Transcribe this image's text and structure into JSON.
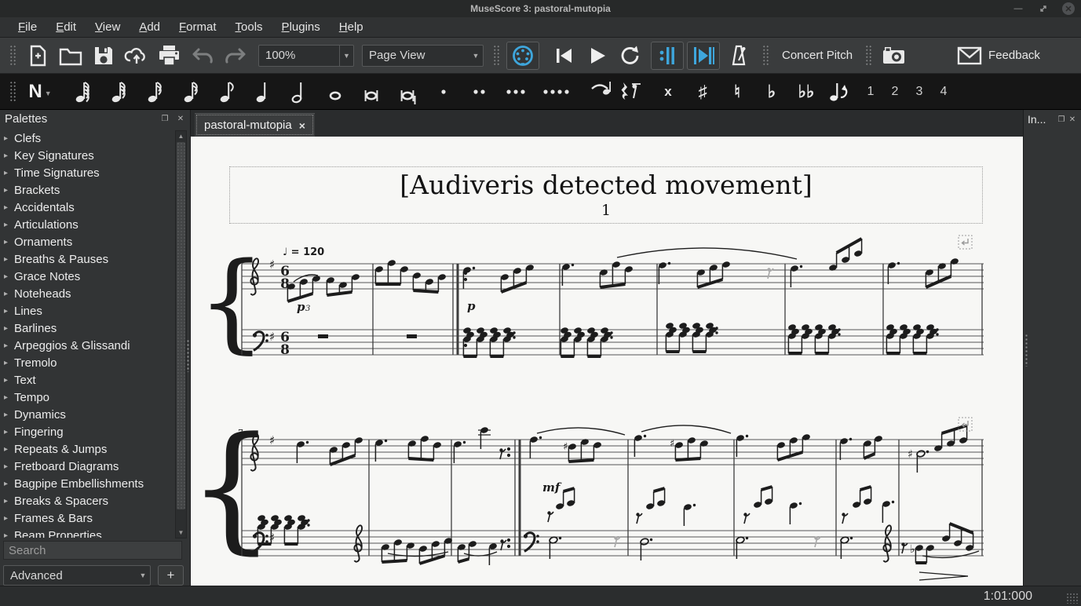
{
  "window": {
    "title": "MuseScore 3: pastoral-mutopia"
  },
  "menu": {
    "items": [
      "File",
      "Edit",
      "View",
      "Add",
      "Format",
      "Tools",
      "Plugins",
      "Help"
    ]
  },
  "toolbar": {
    "zoom_value": "100%",
    "view_mode": "Page View",
    "concert_pitch_label": "Concert Pitch",
    "feedback_label": "Feedback"
  },
  "note_input": {
    "durations": [
      {
        "name": "note-128th",
        "flags": 4,
        "open": false
      },
      {
        "name": "note-64th",
        "flags": 3,
        "open": false
      },
      {
        "name": "note-32nd",
        "flags": 2,
        "open": false
      },
      {
        "name": "note-16th",
        "flags": 2,
        "open": false
      },
      {
        "name": "note-eighth",
        "flags": 1,
        "open": false
      },
      {
        "name": "note-quarter",
        "flags": 0,
        "open": false
      },
      {
        "name": "note-half",
        "flags": 0,
        "open": true
      },
      {
        "name": "note-whole",
        "flags": 0,
        "open": true,
        "nostem": true
      },
      {
        "name": "note-breve",
        "flags": 0,
        "open": true,
        "nostem": true,
        "bars": true
      },
      {
        "name": "note-longa",
        "flags": 0,
        "open": true,
        "bars": true
      }
    ],
    "dots": [
      {
        "name": "augmentation-dot",
        "count": 1
      },
      {
        "name": "double-dot",
        "count": 2
      },
      {
        "name": "triple-dot",
        "count": 3
      },
      {
        "name": "quadruple-dot",
        "count": 4
      }
    ],
    "accidentals": [
      {
        "name": "double-sharp",
        "glyph": "x"
      },
      {
        "name": "sharp",
        "glyph": "♯"
      },
      {
        "name": "natural",
        "glyph": "♮"
      },
      {
        "name": "flat",
        "glyph": "♭"
      },
      {
        "name": "double-flat",
        "glyph": "♭♭"
      }
    ],
    "voices": [
      "1",
      "2",
      "3",
      "4"
    ]
  },
  "palettes": {
    "title": "Palettes",
    "items": [
      "Clefs",
      "Key Signatures",
      "Time Signatures",
      "Brackets",
      "Accidentals",
      "Articulations",
      "Ornaments",
      "Breaths & Pauses",
      "Grace Notes",
      "Noteheads",
      "Lines",
      "Barlines",
      "Arpeggios & Glissandi",
      "Tremolo",
      "Text",
      "Tempo",
      "Dynamics",
      "Fingering",
      "Repeats & Jumps",
      "Fretboard Diagrams",
      "Bagpipe Embellishments",
      "Breaks & Spacers",
      "Frames & Bars",
      "Beam Properties"
    ],
    "search_placeholder": "Search",
    "workspace": "Advanced",
    "add_button": "+"
  },
  "tab": {
    "label": "pastoral-mutopia",
    "close": "×"
  },
  "inspector": {
    "title": "In..."
  },
  "status": {
    "playback_position": "1:01:000"
  },
  "colors": {
    "accent_blue": "#3ea6dc",
    "paper": "#f7f7f5",
    "ink": "#1c1c1c"
  },
  "score": {
    "title": "[Audiveris detected movement]",
    "subtitle": "1",
    "tempo": "♩ = 120",
    "time_signature": "6/8",
    "music": {
      "sys1": [
        [
          "st",
          65,
          1010,
          162
        ],
        [
          "st",
          65,
          1010,
          246
        ],
        [
          "br",
          52,
          162,
          278
        ],
        [
          "bl",
          65,
          162,
          278
        ],
        [
          "bl",
          232,
          162,
          278
        ],
        [
          "bl",
          334,
          162,
          278
        ],
        [
          "bl",
          340,
          162,
          278,
          3
        ],
        [
          "do",
          350,
          [
            174,
            182
          ]
        ],
        [
          "do",
          350,
          [
            258,
            266
          ]
        ],
        [
          "bl",
          470,
          162,
          278
        ],
        [
          "bl",
          594,
          162,
          278
        ],
        [
          "bl",
          757,
          162,
          278
        ],
        [
          "bl",
          882,
          162,
          278
        ],
        [
          "bl",
          1008,
          162,
          278
        ],
        [
          "gc",
          76,
          162
        ],
        [
          "fc",
          80,
          246
        ],
        [
          "tx",
          100,
          168,
          "♯",
          15,
          "b"
        ],
        [
          "tx",
          100,
          260,
          "♯",
          15,
          "b"
        ],
        [
          "ts",
          114,
          162
        ],
        [
          "ts",
          114,
          246
        ],
        [
          "tx",
          117,
          151,
          "♩ = 120",
          13,
          "b"
        ],
        [
          "tx",
          135,
          222,
          "p",
          15,
          "ibf"
        ],
        [
          "tx",
          146,
          222,
          "3",
          10,
          "if"
        ],
        [
          "tx",
          352,
          221,
          "p",
          15,
          "ibf"
        ],
        [
          "ng",
          128,
          [
            [
              0,
              191
            ],
            [
              16,
              185
            ],
            [
              32,
              181
            ]
          ]
        ],
        [
          "ng",
          178,
          [
            [
              0,
              183
            ],
            [
              16,
              189
            ],
            [
              32,
              179
            ]
          ]
        ],
        [
          "sl",
          131,
          185,
          162,
          177,
          -8
        ],
        [
          "ng",
          240,
          [
            [
              0,
              169
            ],
            [
              16,
              161
            ],
            [
              32,
              169
            ]
          ]
        ],
        [
          "ng",
          288,
          [
            [
              0,
              177
            ],
            [
              16,
              185
            ],
            [
              32,
              179
            ]
          ]
        ],
        [
          "nt",
          352,
          170,
          "d"
        ],
        [
          "ng",
          400,
          [
            [
              0,
              179
            ],
            [
              16,
              171
            ],
            [
              32,
              167
            ]
          ]
        ],
        [
          "nt",
          478,
          166,
          "d"
        ],
        [
          "ng",
          526,
          [
            [
              0,
              173
            ],
            [
              16,
              163
            ],
            [
              32,
              169
            ]
          ]
        ],
        [
          "sl",
          543,
          154,
          772,
          156,
          -26
        ],
        [
          "nt",
          601,
          164,
          "d"
        ],
        [
          "ng",
          650,
          [
            [
              0,
              173
            ],
            [
              16,
              167
            ],
            [
              32,
              163
            ]
          ]
        ],
        [
          "r8",
          735,
          168,
          "g"
        ],
        [
          "nt",
          769,
          168,
          "d"
        ],
        [
          "ng",
          818,
          [
            [
              0,
              167
            ],
            [
              16,
              157
            ],
            [
              32,
              149
            ]
          ],
          "u"
        ],
        [
          "nt",
          893,
          164,
          "d"
        ],
        [
          "ng",
          941,
          [
            [
              0,
              173
            ],
            [
              16,
              165
            ],
            [
              32,
              159
            ]
          ]
        ],
        [
          "mr",
          162,
          252
        ],
        [
          "mr",
          275,
          252
        ],
        [
          "ch",
          352,
          247
        ],
        [
          "ch",
          476,
          247
        ],
        [
          "ch",
          610,
          241
        ],
        [
          "ch",
          766,
          243
        ],
        [
          "ch",
          891,
          243
        ],
        [
          "bk",
          978,
          126
        ]
      ],
      "sys2": [
        [
          "st",
          65,
          1010,
          386
        ],
        [
          "st",
          65,
          1010,
          502
        ],
        [
          "br",
          52,
          386,
          534
        ],
        [
          "bl",
          65,
          386,
          534
        ],
        [
          "bl",
          227,
          386,
          534
        ],
        [
          "bl",
          332,
          386,
          534
        ],
        [
          "bl",
          413,
          386,
          534
        ],
        [
          "bl",
          419,
          386,
          534,
          3
        ],
        [
          "do",
          405,
          [
            398,
            406
          ]
        ],
        [
          "do",
          405,
          [
            514,
            522
          ]
        ],
        [
          "bl",
          557,
          386,
          534
        ],
        [
          "bl",
          692,
          386,
          534
        ],
        [
          "bl",
          822,
          386,
          534
        ],
        [
          "bl",
          902,
          386,
          534
        ],
        [
          "bl",
          1008,
          386,
          534
        ],
        [
          "gc",
          76,
          386
        ],
        [
          "fc",
          80,
          502
        ],
        [
          "tx",
          100,
          392,
          "♯",
          15,
          "b"
        ],
        [
          "tx",
          100,
          516,
          "♯",
          15,
          "b"
        ],
        [
          "tx",
          60,
          381,
          "7",
          11,
          "f"
        ],
        [
          "nt",
          140,
          392,
          "d"
        ],
        [
          "ng",
          182,
          [
            [
              0,
              399
            ],
            [
              16,
              393
            ],
            [
              32,
              387
            ]
          ]
        ],
        [
          "nt",
          240,
          390,
          "d"
        ],
        [
          "ng",
          282,
          [
            [
              0,
              391
            ],
            [
              16,
              385
            ],
            [
              32,
              393
            ]
          ]
        ],
        [
          "nt",
          340,
          392,
          "d"
        ],
        [
          "ld",
          374,
          380
        ],
        [
          "nt",
          374,
          374,
          ""
        ],
        [
          "r8",
          394,
          398
        ],
        [
          "nt",
          437,
          386,
          "d"
        ],
        [
          "sl",
          441,
          378,
          553,
          380,
          -16
        ],
        [
          "tx",
          474,
          399,
          "♯",
          13,
          "b"
        ],
        [
          "ng",
          486,
          [
            [
              0,
              395
            ],
            [
              16,
              389
            ],
            [
              32,
              393
            ]
          ]
        ],
        [
          "nt",
          570,
          384,
          "d"
        ],
        [
          "sl",
          574,
          376,
          688,
          378,
          -18
        ],
        [
          "tx",
          610,
          395,
          "♯",
          13,
          "b"
        ],
        [
          "ng",
          622,
          [
            [
              0,
              393
            ],
            [
              16,
              387
            ],
            [
              32,
              391
            ]
          ]
        ],
        [
          "nt",
          700,
          384,
          "d"
        ],
        [
          "ng",
          752,
          [
            [
              0,
              393
            ],
            [
              16,
              387
            ],
            [
              32,
              383
            ]
          ]
        ],
        [
          "nt",
          832,
          388,
          "d"
        ],
        [
          "ng",
          862,
          [
            [
              0,
              391
            ],
            [
              14,
              385
            ]
          ]
        ],
        [
          "tx",
          913,
          409,
          "♯",
          14,
          "b"
        ],
        [
          "nt",
          930,
          404,
          "do"
        ],
        [
          "ng",
          952,
          [
            [
              0,
              397
            ],
            [
              16,
              391
            ],
            [
              32,
              387
            ]
          ],
          "u"
        ],
        [
          "ch",
          90,
          486
        ],
        [
          "gc",
          208,
          502
        ],
        [
          "ng",
          248,
          [
            [
              0,
              523
            ],
            [
              16,
              517
            ],
            [
              32,
              521
            ]
          ]
        ],
        [
          "ng",
          296,
          [
            [
              0,
              525
            ],
            [
              16,
              519
            ],
            [
              32,
              515
            ]
          ]
        ],
        [
          "sl",
          251,
          531,
          328,
          529,
          9
        ],
        [
          "ng",
          345,
          [
            [
              0,
              523
            ],
            [
              14,
              519
            ]
          ]
        ],
        [
          "nt",
          385,
          522,
          ""
        ],
        [
          "r8",
          395,
          514
        ],
        [
          "sl",
          348,
          531,
          390,
          529,
          8
        ],
        [
          "fc",
          425,
          502
        ],
        [
          "tx",
          448,
          452,
          "mf",
          15,
          "ibf"
        ],
        [
          "r8",
          455,
          478
        ],
        [
          "ng",
          470,
          [
            [
              0,
              471
            ],
            [
              14,
              467
            ]
          ],
          "u"
        ],
        [
          "nt",
          462,
          514,
          "do"
        ],
        [
          "r8",
          540,
          510,
          "g"
        ],
        [
          "r8",
          568,
          480
        ],
        [
          "ng",
          585,
          [
            [
              0,
              471
            ],
            [
              14,
              467
            ]
          ],
          "u"
        ],
        [
          "nt",
          633,
          472,
          "d"
        ],
        [
          "nt",
          578,
          516,
          "do"
        ],
        [
          "r8",
          705,
          480
        ],
        [
          "ng",
          722,
          [
            [
              0,
              469
            ],
            [
              14,
              465
            ]
          ],
          "u"
        ],
        [
          "nt",
          768,
          470,
          "d"
        ],
        [
          "nt",
          700,
          514,
          "do"
        ],
        [
          "r8",
          795,
          510,
          "g"
        ],
        [
          "r8",
          830,
          480
        ],
        [
          "ng",
          848,
          [
            [
              0,
              469
            ],
            [
              14,
              465
            ]
          ],
          "u"
        ],
        [
          "nt",
          886,
          468,
          "d"
        ],
        [
          "nt",
          833,
          514,
          "do"
        ],
        [
          "gc",
          882,
          502
        ],
        [
          "r8",
          906,
          518
        ],
        [
          "tx",
          916,
          530,
          "♭",
          14,
          "b"
        ],
        [
          "ng",
          928,
          [
            [
              0,
              524
            ],
            [
              14,
              524
            ]
          ]
        ],
        [
          "ng",
          962,
          [
            [
              0,
              512
            ],
            [
              15,
              518
            ],
            [
              30,
              524
            ]
          ],
          "u"
        ],
        [
          "sl",
          932,
          534,
          1004,
          528,
          10
        ],
        [
          "hp",
          928,
          990,
          560
        ],
        [
          "bk",
          978,
          358
        ]
      ]
    }
  }
}
